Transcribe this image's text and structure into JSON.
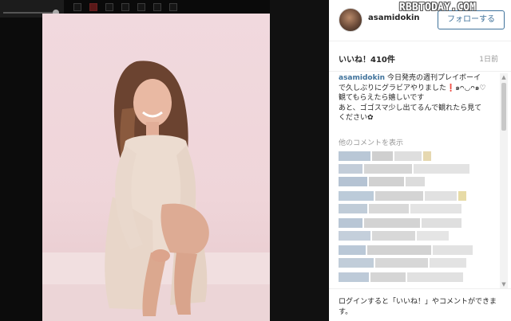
{
  "post": {
    "username": "asamidokin",
    "follow_label": "フォローする",
    "likes_label": "いいね！410件",
    "time_ago": "1日前",
    "caption_user": "asamidokin",
    "caption_lines": [
      " 今日発売の週刊プレイボーイ",
      "で久しぶりにグラビアやりました❗️๑ᴖ◡ᴖ๑♡",
      "観てもらえたら嬉しいです",
      "あと、ゴゴスマ少し出てるんで観れたら見て",
      "ください✿"
    ],
    "more_comments_label": "他のコメントを表示",
    "login_prompt": "ログインすると「いいね！」やコメントができます。"
  },
  "watermark": "RBBTODAY.COM",
  "colors": {
    "link": "#3f729b",
    "viewer_bg": "#0c0c0c",
    "photo_bg": "#f1d9de"
  },
  "icons": {
    "scroll_up": "▲",
    "scroll_down": "▼"
  }
}
